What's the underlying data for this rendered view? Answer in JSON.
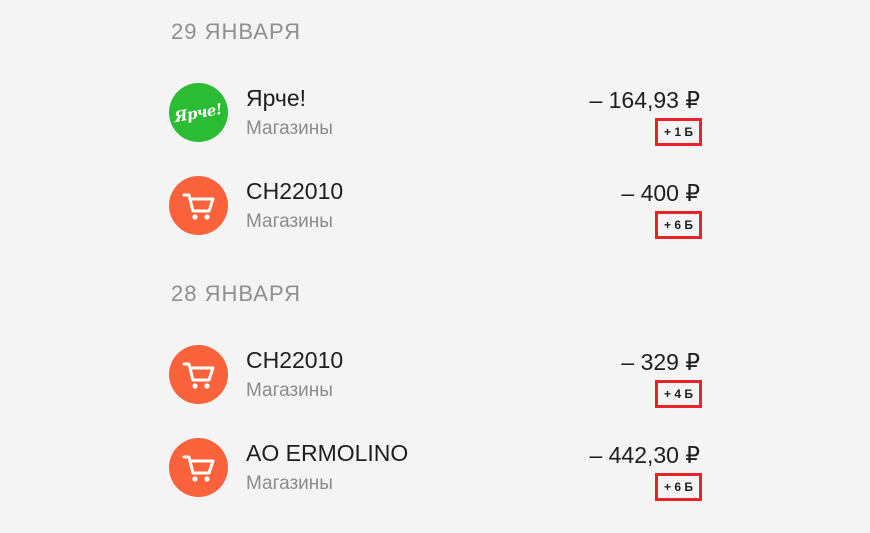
{
  "groups": [
    {
      "date": "29 ЯНВАРЯ",
      "transactions": [
        {
          "title": "Ярче!",
          "category": "Магазины",
          "amount": "– 164,93 ₽",
          "bonus": "+ 1 Б",
          "icon": "yarche-logo-icon",
          "logo_text": "Ярче!"
        },
        {
          "title": "CH22010",
          "category": "Магазины",
          "amount": "– 400 ₽",
          "bonus": "+ 6 Б",
          "icon": "shopping-cart-icon"
        }
      ]
    },
    {
      "date": "28 ЯНВАРЯ",
      "transactions": [
        {
          "title": "CH22010",
          "category": "Магазины",
          "amount": "– 329 ₽",
          "bonus": "+ 4 Б",
          "icon": "shopping-cart-icon"
        },
        {
          "title": "AO ERMOLINO",
          "category": "Магазины",
          "amount": "– 442,30 ₽",
          "bonus": "+ 6 Б",
          "icon": "shopping-cart-icon"
        }
      ]
    }
  ],
  "colors": {
    "background": "#f4f4f4",
    "cart_icon_bg": "#fa623c",
    "brand_icon_bg": "#2cbb35",
    "bonus_highlight": "#e8232c",
    "secondary_text": "#8b8b8b"
  }
}
